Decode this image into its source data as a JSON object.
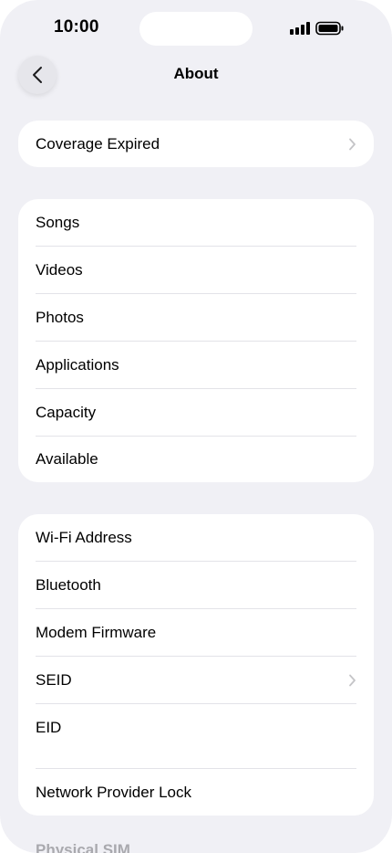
{
  "status_bar": {
    "time": "10:00"
  },
  "nav": {
    "title": "About",
    "back_icon": "chevron-left-icon"
  },
  "coverage": {
    "label": "Coverage Expired"
  },
  "media_group": {
    "items": [
      {
        "label": "Songs"
      },
      {
        "label": "Videos"
      },
      {
        "label": "Photos"
      },
      {
        "label": "Applications"
      },
      {
        "label": "Capacity"
      },
      {
        "label": "Available"
      }
    ]
  },
  "network_group": {
    "items": [
      {
        "label": "Wi-Fi Address"
      },
      {
        "label": "Bluetooth"
      },
      {
        "label": "Modem Firmware"
      },
      {
        "label": "SEID"
      },
      {
        "label": "EID"
      },
      {
        "label": "Network Provider Lock"
      }
    ]
  },
  "footer": {
    "section_label": "Physical SIM"
  },
  "colors": {
    "background": "#f0f0f5",
    "card": "#ffffff",
    "chevron": "#c4c4c7",
    "separator": "#e3e3e8"
  }
}
